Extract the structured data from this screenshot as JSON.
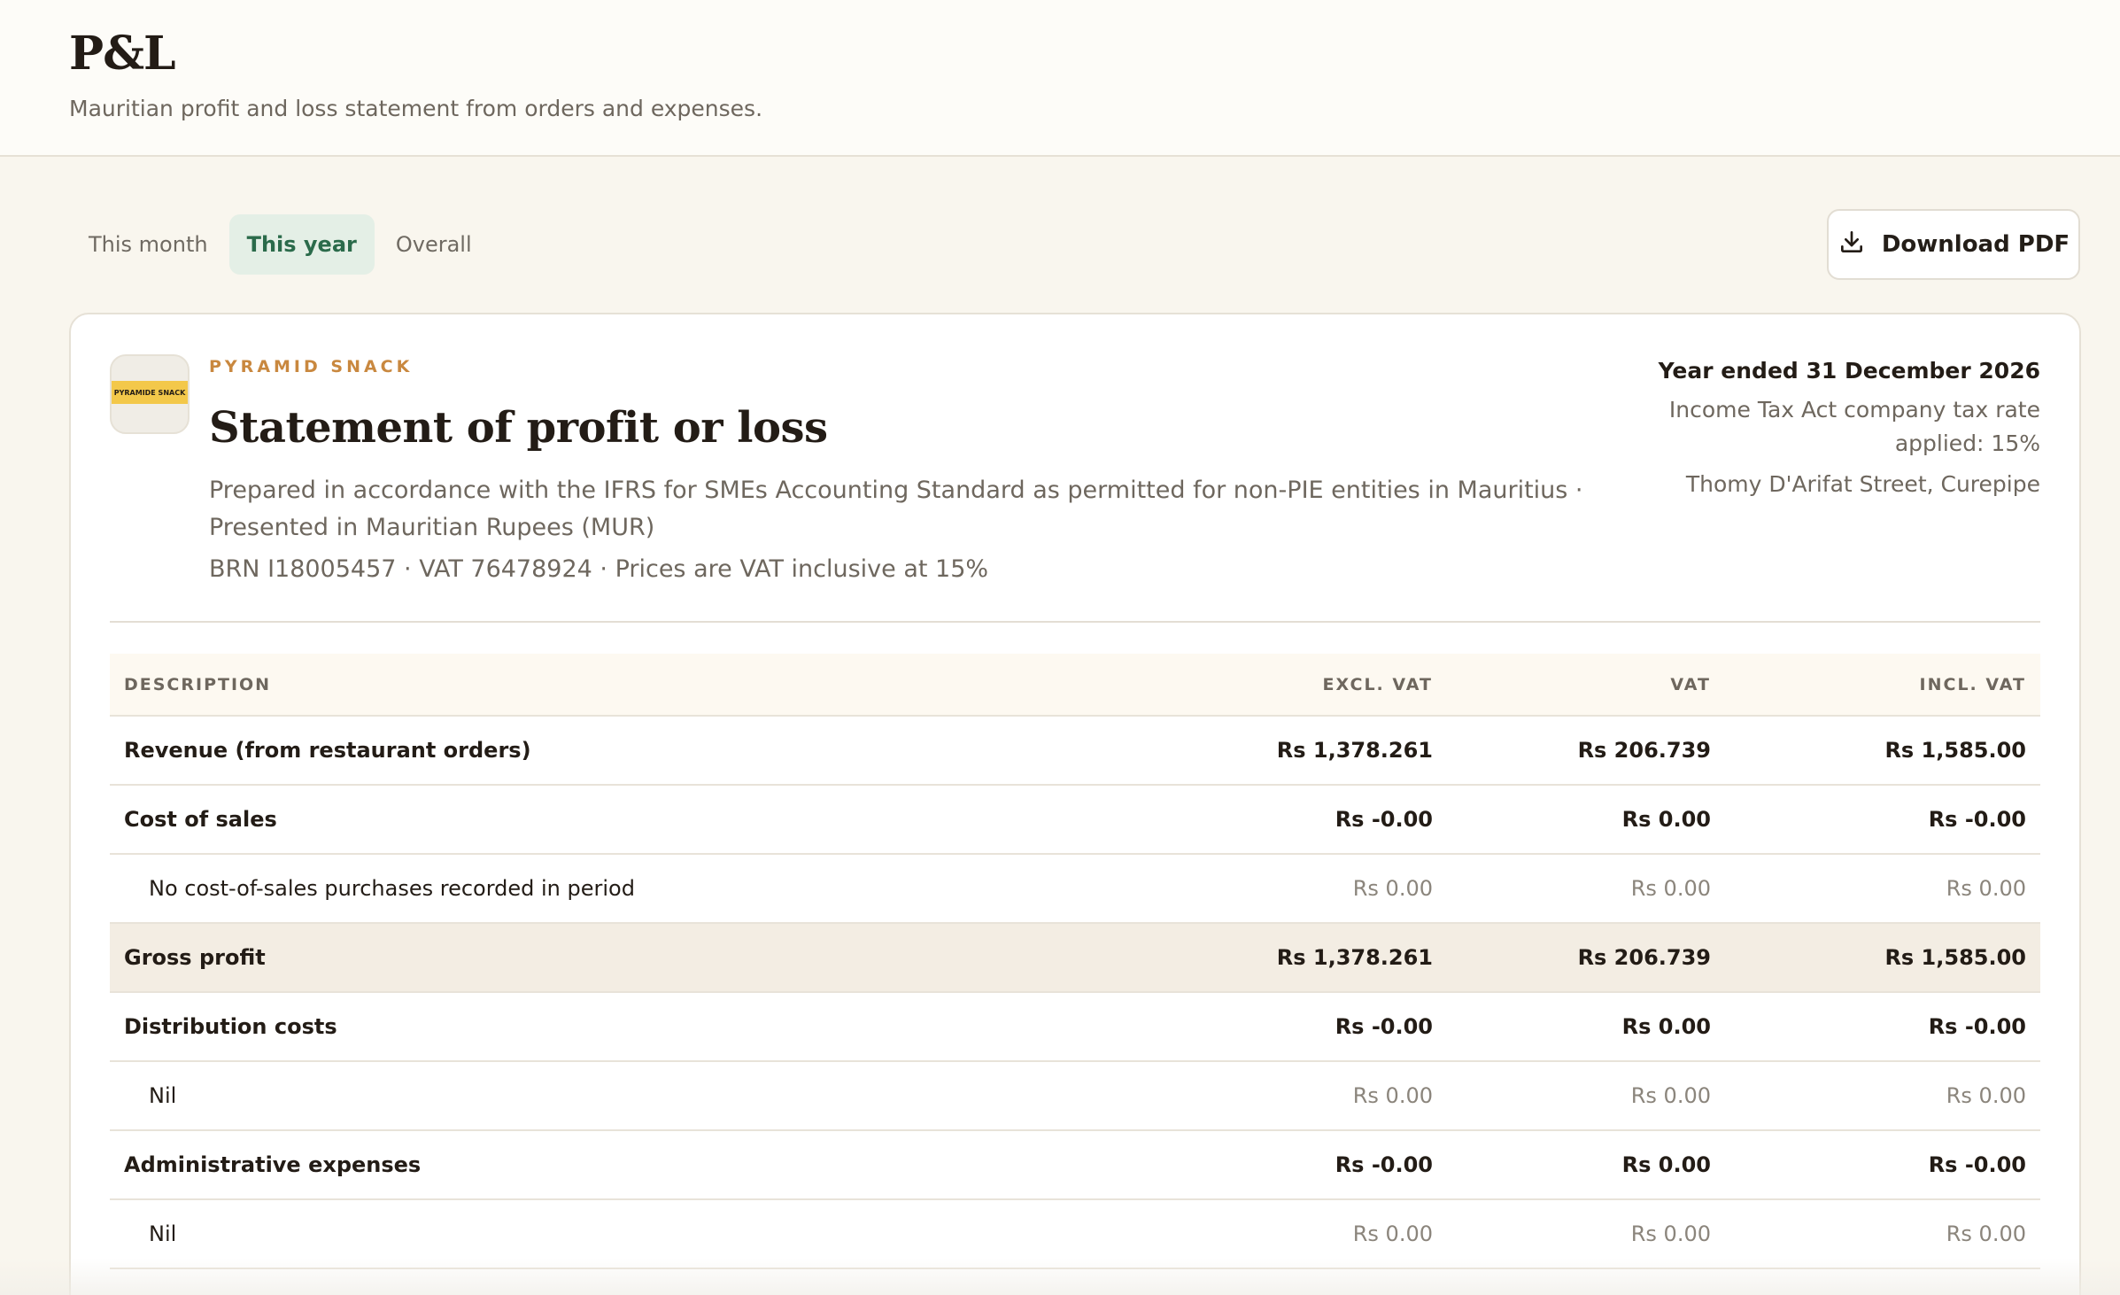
{
  "header": {
    "title": "P&L",
    "subtitle": "Mauritian profit and loss statement from orders and expenses."
  },
  "tabs": [
    {
      "label": "This month",
      "active": false
    },
    {
      "label": "This year",
      "active": true
    },
    {
      "label": "Overall",
      "active": false
    }
  ],
  "actions": {
    "download_label": "Download PDF",
    "download_icon": "download-icon"
  },
  "statement": {
    "logo_text": "PYRAMIDE SNACK",
    "brand": "PYRAMID SNACK",
    "title": "Statement of profit or loss",
    "prepared": "Prepared in accordance with the IFRS for SMEs Accounting Standard as permitted for non-PIE entities in Mauritius · Presented in Mauritian Rupees (MUR)",
    "identifiers": "BRN I18005457 · VAT 76478924 · Prices are VAT inclusive at 15%",
    "period": "Year ended 31 December 2026",
    "tax_rate": "Income Tax Act company tax rate applied: 15%",
    "address": "Thomy D'Arifat Street, Curepipe"
  },
  "table": {
    "headers": [
      "DESCRIPTION",
      "EXCL. VAT",
      "VAT",
      "INCL. VAT"
    ],
    "rows": [
      {
        "type": "main",
        "desc": "Revenue (from restaurant orders)",
        "excl": "Rs 1,378.261",
        "vat": "Rs 206.739",
        "incl": "Rs 1,585.00"
      },
      {
        "type": "main",
        "desc": "Cost of sales",
        "excl": "Rs -0.00",
        "vat": "Rs 0.00",
        "incl": "Rs -0.00"
      },
      {
        "type": "sub",
        "desc": "No cost-of-sales purchases recorded in period",
        "excl": "Rs 0.00",
        "vat": "Rs 0.00",
        "incl": "Rs 0.00"
      },
      {
        "type": "total",
        "desc": "Gross profit",
        "excl": "Rs 1,378.261",
        "vat": "Rs 206.739",
        "incl": "Rs 1,585.00"
      },
      {
        "type": "main",
        "desc": "Distribution costs",
        "excl": "Rs -0.00",
        "vat": "Rs 0.00",
        "incl": "Rs -0.00"
      },
      {
        "type": "sub",
        "desc": "Nil",
        "excl": "Rs 0.00",
        "vat": "Rs 0.00",
        "incl": "Rs 0.00"
      },
      {
        "type": "main",
        "desc": "Administrative expenses",
        "excl": "Rs -0.00",
        "vat": "Rs 0.00",
        "incl": "Rs -0.00"
      },
      {
        "type": "sub",
        "desc": "Nil",
        "excl": "Rs 0.00",
        "vat": "Rs 0.00",
        "incl": "Rs 0.00"
      }
    ]
  },
  "colors": {
    "accent_green": "#2b6b4b",
    "brand_orange": "#c9883f",
    "logo_yellow": "#f3c84a"
  }
}
